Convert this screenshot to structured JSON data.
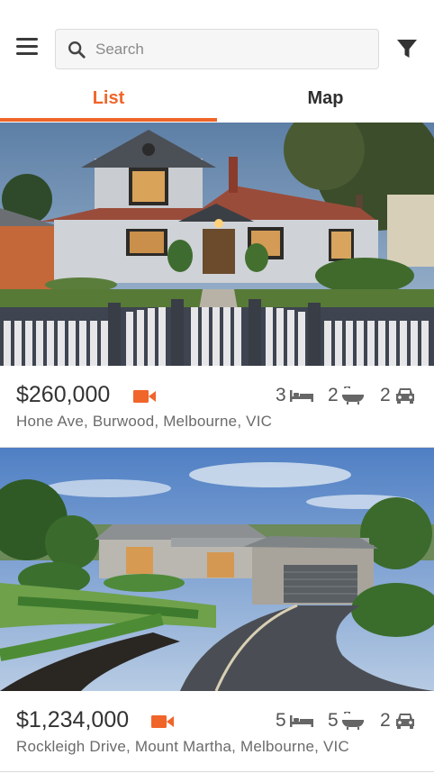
{
  "search": {
    "placeholder": "Search",
    "value": ""
  },
  "tabs": [
    {
      "label": "List",
      "active": true
    },
    {
      "label": "Map",
      "active": false
    }
  ],
  "accent_color": "#f0652a",
  "listings": [
    {
      "price": "$260,000",
      "has_video": true,
      "address": "Hone Ave, Burwood, Melbourne, VIC",
      "bedrooms": "3",
      "bathrooms": "2",
      "parking": "2"
    },
    {
      "price": "$1,234,000",
      "has_video": true,
      "address": "Rockleigh Drive, Mount Martha, Melbourne, VIC",
      "bedrooms": "5",
      "bathrooms": "5",
      "parking": "2"
    }
  ]
}
